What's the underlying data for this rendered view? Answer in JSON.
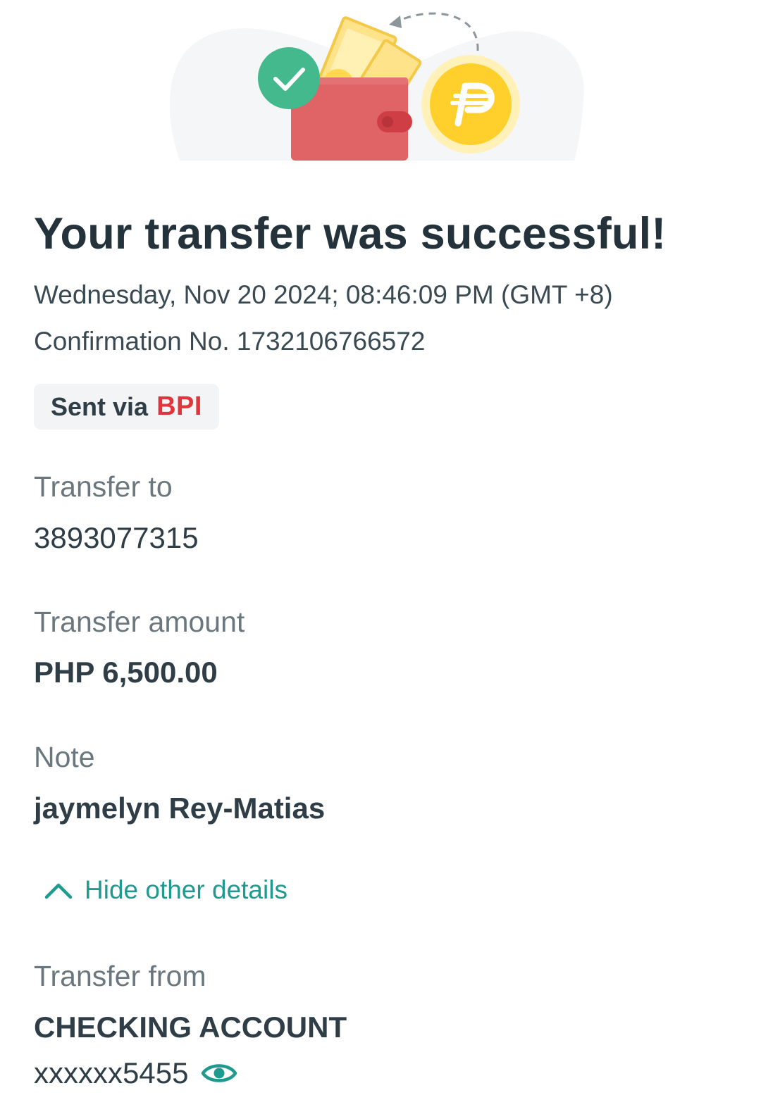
{
  "header": {
    "title": "Your transfer was successful!",
    "datetime": "Wednesday, Nov 20 2024; 08:46:09 PM (GMT +8)",
    "confirmation": "Confirmation No. 1732106766572"
  },
  "sent_via": {
    "label": "Sent via",
    "bank": "BPI"
  },
  "details": {
    "transfer_to_label": "Transfer to",
    "transfer_to_value": "3893077315",
    "amount_label": "Transfer amount",
    "amount_value": "PHP 6,500.00",
    "note_label": "Note",
    "note_value": "jaymelyn Rey-Matias"
  },
  "toggle": {
    "label": "Hide other details"
  },
  "other_details": {
    "transfer_from_label": "Transfer from",
    "account_type": "CHECKING ACCOUNT",
    "account_masked": "xxxxxx5455"
  },
  "icons": {
    "hero": "wallet-illustration",
    "check": "check-circle-icon",
    "coin": "peso-coin-icon",
    "chevron": "chevron-up-icon",
    "eye": "eye-icon"
  },
  "colors": {
    "accent": "#1f9a8e",
    "success": "#43b98d",
    "bank_red": "#e0353c",
    "wallet_red": "#e06466",
    "coin_yellow": "#ffd02b"
  }
}
